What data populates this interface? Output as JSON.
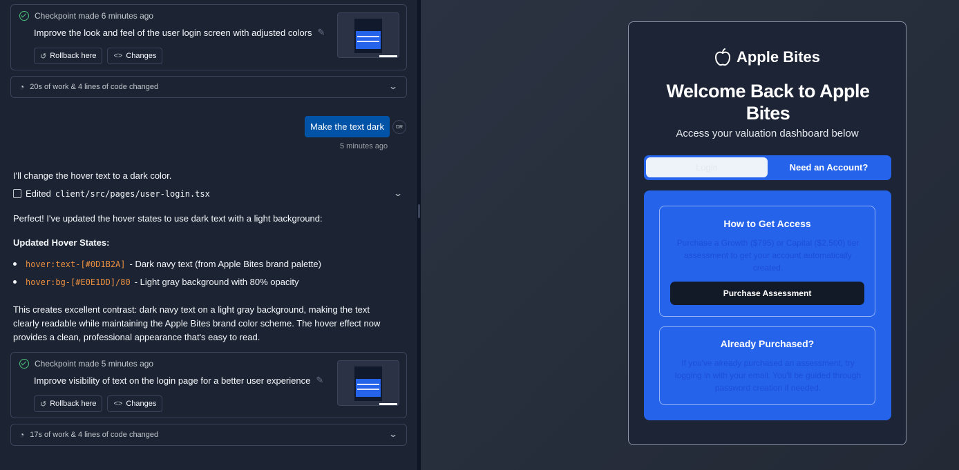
{
  "chat": {
    "checkpoint1": {
      "made": "Checkpoint made 6 minutes ago",
      "title": "Improve the look and feel of the user login screen with adjusted colors",
      "rollback_label": "Rollback here",
      "changes_label": "Changes"
    },
    "work1": "20s of work & 4 lines of code changed",
    "user_message": "Make the text dark",
    "user_avatar": "DR",
    "user_time": "5 minutes ago",
    "reply_intro": "I'll change the hover text to a dark color.",
    "edited_label": "Edited",
    "edited_file": "client/src/pages/user-login.tsx",
    "reply_perfect": "Perfect! I've updated the hover states to use dark text with a light background:",
    "updated_heading": "Updated Hover States:",
    "bullets": [
      {
        "code": "hover:text-[#0D1B2A]",
        "text": "- Dark navy text (from Apple Bites brand palette)"
      },
      {
        "code": "hover:bg-[#E0E1DD]/80",
        "text": "- Light gray background with 80% opacity"
      }
    ],
    "reply_summary": "This creates excellent contrast: dark navy text on a light gray background, making the text clearly readable while maintaining the Apple Bites brand color scheme. The hover effect now provides a clean, professional appearance that's easy to read.",
    "checkpoint2": {
      "made": "Checkpoint made 5 minutes ago",
      "title": "Improve visibility of text on the login page for a better user experience",
      "rollback_label": "Rollback here",
      "changes_label": "Changes"
    },
    "work2": "17s of work & 4 lines of code changed"
  },
  "preview": {
    "brand": "Apple Bites",
    "welcome": "Welcome Back to Apple Bites",
    "subtitle": "Access your valuation dashboard below",
    "tab_login": "Login",
    "tab_signup": "Need an Account?",
    "access_title": "How to Get Access",
    "access_desc": "Purchase a Growth ($795) or Capital ($2,500) tier assessment to get your account automatically created.",
    "purchase_button": "Purchase Assessment",
    "purchased_title": "Already Purchased?",
    "purchased_desc": "If you've already purchased an assessment, try logging in with your email. You'll be guided through password creation if needed."
  },
  "colors": {
    "panel_bg": "#1c2333",
    "accent_blue": "#2563eb",
    "user_bubble": "#0053a6",
    "code_orange": "#ea8f3f",
    "check_green": "#4cc37a"
  }
}
